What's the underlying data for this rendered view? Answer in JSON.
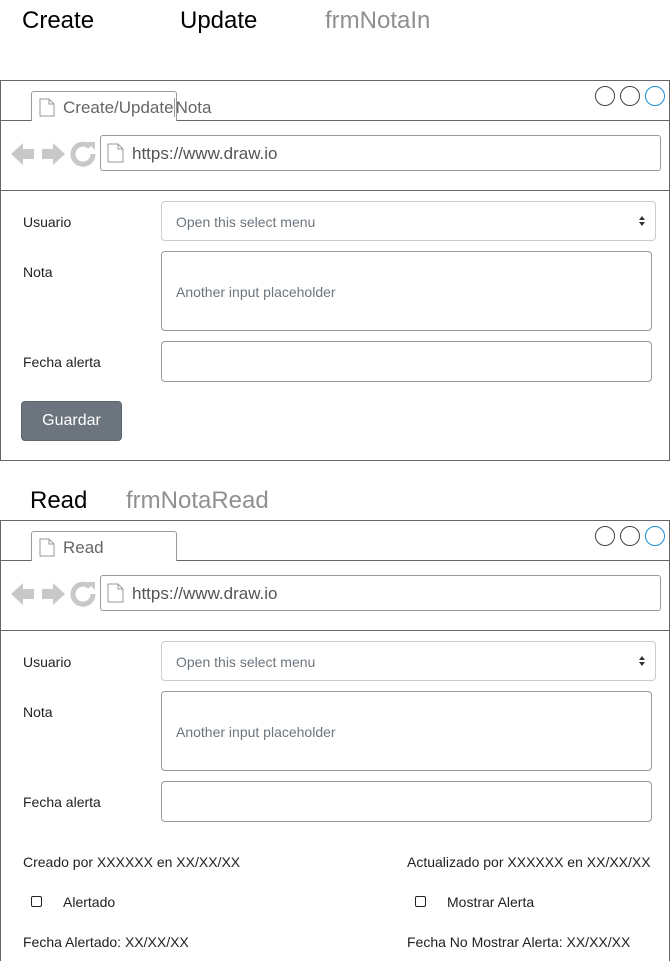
{
  "headings": {
    "create": "Create",
    "update": "Update",
    "form_create": "frmNotaIn",
    "read": "Read",
    "form_read": "frmNotaRead"
  },
  "create_window": {
    "tab_part1": "Create/Update",
    "tab_part2": "Nota",
    "url": "https://www.draw.io",
    "usuario_label": "Usuario",
    "usuario_select": "Open this select menu",
    "nota_label": "Nota",
    "nota_placeholder": "Another input placeholder",
    "fecha_label": "Fecha alerta",
    "save_button": "Guardar"
  },
  "read_window": {
    "tab": "Read",
    "url": "https://www.draw.io",
    "usuario_label": "Usuario",
    "usuario_select": "Open this select menu",
    "nota_label": "Nota",
    "nota_placeholder": "Another input placeholder",
    "fecha_label": "Fecha alerta",
    "created_by": "Creado por XXXXXX en XX/XX/XX",
    "updated_by": "Actualizado por XXXXXX en XX/XX/XX",
    "alertado_label": "Alertado",
    "mostrar_alerta_label": "Mostrar Alerta",
    "fecha_alertado": "Fecha Alertado: XX/XX/XX",
    "fecha_no_mostrar": "Fecha No Mostrar Alerta: XX/XX/XX"
  },
  "colors": {
    "button_bg": "#6c757d",
    "muted_heading": "#909090",
    "window_control_accent": "#1a8fd1"
  }
}
